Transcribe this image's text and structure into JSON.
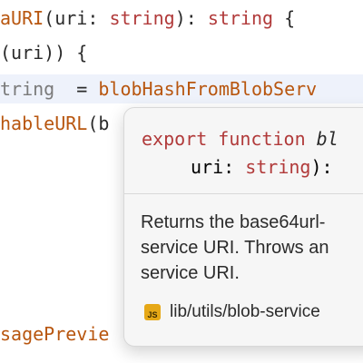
{
  "editor": {
    "line1": {
      "fn": "aURI",
      "open": "(",
      "param": "uri",
      "colon": ": ",
      "type": "string",
      "close": "): ",
      "ret": "string",
      "brace": " {"
    },
    "line2": {
      "text": "(uri)) {"
    },
    "line3": {
      "prefix": "tring",
      "eq": "  = ",
      "call": "blobHashFromBlobServ"
    },
    "line4": {
      "fn": "hableURL",
      "rest": "(b"
    },
    "line5": {
      "fn": "sagePrevie"
    }
  },
  "popup": {
    "sig_kw1": "export",
    "sig_kw2": "function",
    "sig_fname": "bl",
    "sig_param": "uri",
    "sig_colon": ": ",
    "sig_type": "string",
    "sig_end": "):",
    "doc_lines": [
      "Returns the base64url-",
      "service URI. Throws an",
      "service URI."
    ],
    "source_badge": "JS",
    "source_path": "lib/utils/blob-service"
  },
  "colors": {
    "function": "#b8560f",
    "keyword": "#b13a3a",
    "highlight_line": "#eef2fb",
    "popup_bg": "#f6f6f6",
    "js_badge": "#e6a817"
  }
}
